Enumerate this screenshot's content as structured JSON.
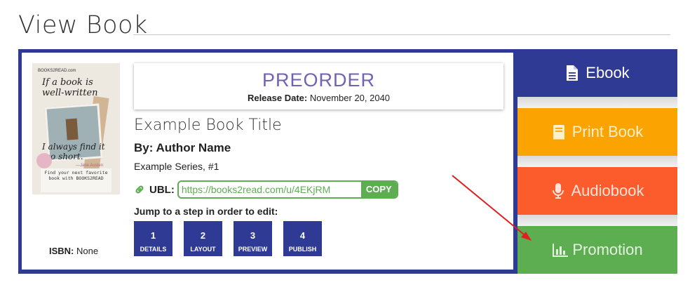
{
  "page": {
    "title": "View Book"
  },
  "status": {
    "label": "PREORDER",
    "release_label": "Release Date:",
    "release_date": "November 20, 2040"
  },
  "book": {
    "title": "Example Book Title",
    "author_line": "By: Author Name",
    "series": "Example Series, #1",
    "isbn_label": "ISBN:",
    "isbn_value": "None"
  },
  "cover": {
    "brand": "BOOKS2READ.com",
    "quote_top": "If a book is well-written",
    "quote_bottom": "I always find it too short.",
    "attribution": "—Jane Austen",
    "promo": "Find your next favorite book with BOOKS2READ"
  },
  "ubl": {
    "label": "UBL:",
    "url": "https://books2read.com/u/4EKjRM",
    "copy_label": "COPY"
  },
  "steps": {
    "intro": "Jump to a step in order to edit:",
    "items": [
      {
        "number": "1",
        "label": "DETAILS"
      },
      {
        "number": "2",
        "label": "LAYOUT"
      },
      {
        "number": "3",
        "label": "PREVIEW"
      },
      {
        "number": "4",
        "label": "PUBLISH"
      }
    ]
  },
  "formats": {
    "ebook": "Ebook",
    "print": "Print Book",
    "audio": "Audiobook",
    "promotion": "Promotion"
  },
  "colors": {
    "navy": "#2e3a93",
    "preorder": "#7262b4",
    "green": "#5cae50",
    "orange": "#fba300",
    "red_orange": "#fc5b2c",
    "annotation_arrow": "#e02020"
  },
  "icons": {
    "link": "link-icon",
    "ebook": "file-text-icon",
    "print": "book-icon",
    "audio": "microphone-icon",
    "promotion": "bar-chart-icon"
  }
}
